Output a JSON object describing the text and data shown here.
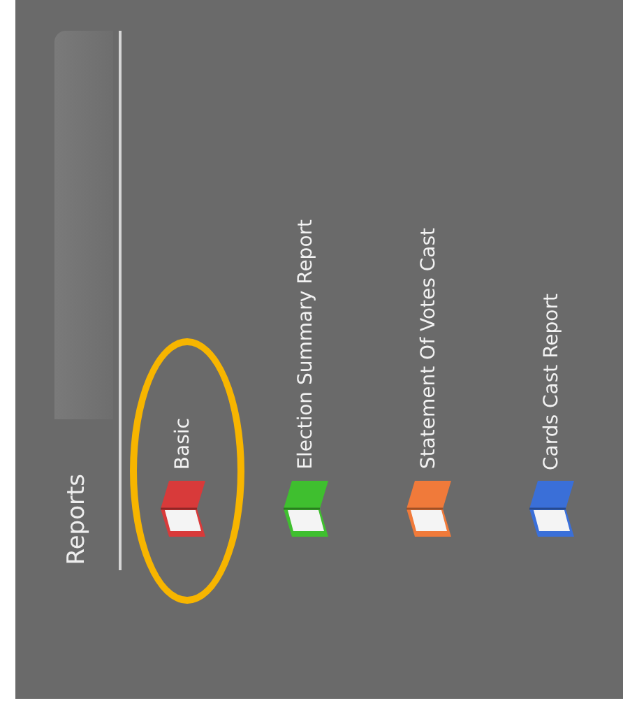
{
  "panel": {
    "title": "Reports"
  },
  "reports": [
    {
      "label": "Basic",
      "color": "#d83a3a",
      "circled": true
    },
    {
      "label": "Election Summary Report",
      "color": "#3fbf2f",
      "circled": false
    },
    {
      "label": "Statement Of Votes Cast",
      "color": "#f07a3a",
      "circled": false
    },
    {
      "label": "Cards Cast Report",
      "color": "#3a6fd8",
      "circled": false
    }
  ]
}
